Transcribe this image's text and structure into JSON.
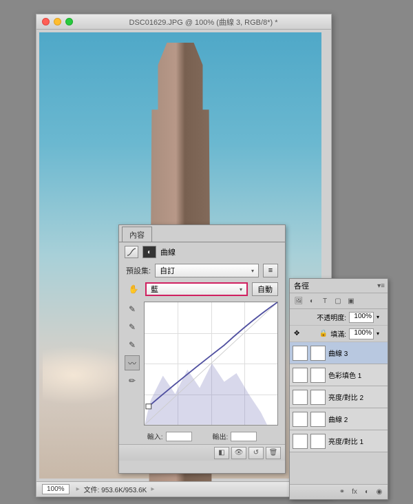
{
  "window": {
    "title": "DSC01629.JPG @ 100% (曲線 3, RGB/8*) *"
  },
  "statusbar": {
    "zoom": "100%",
    "filesize": "文件: 953.6K/953.6K"
  },
  "content_panel": {
    "tab": "內容",
    "adjustment_type": "曲線",
    "preset_label": "預設集:",
    "preset_value": "自訂",
    "channel_value": "藍",
    "auto_label": "自動",
    "input_label": "輸入:",
    "output_label": "輸出:"
  },
  "layers_panel": {
    "tab_partial": "各徑",
    "opacity_label": "不透明度:",
    "opacity_value": "100%",
    "fill_label": "填滿:",
    "fill_value": "100%",
    "layers": [
      {
        "name": "曲線 3",
        "selected": true
      },
      {
        "name": "色彩填色 1",
        "selected": false
      },
      {
        "name": "亮度/對比 2",
        "selected": false
      },
      {
        "name": "曲線 2",
        "selected": false
      },
      {
        "name": "亮度/對比 1",
        "selected": false
      }
    ]
  }
}
